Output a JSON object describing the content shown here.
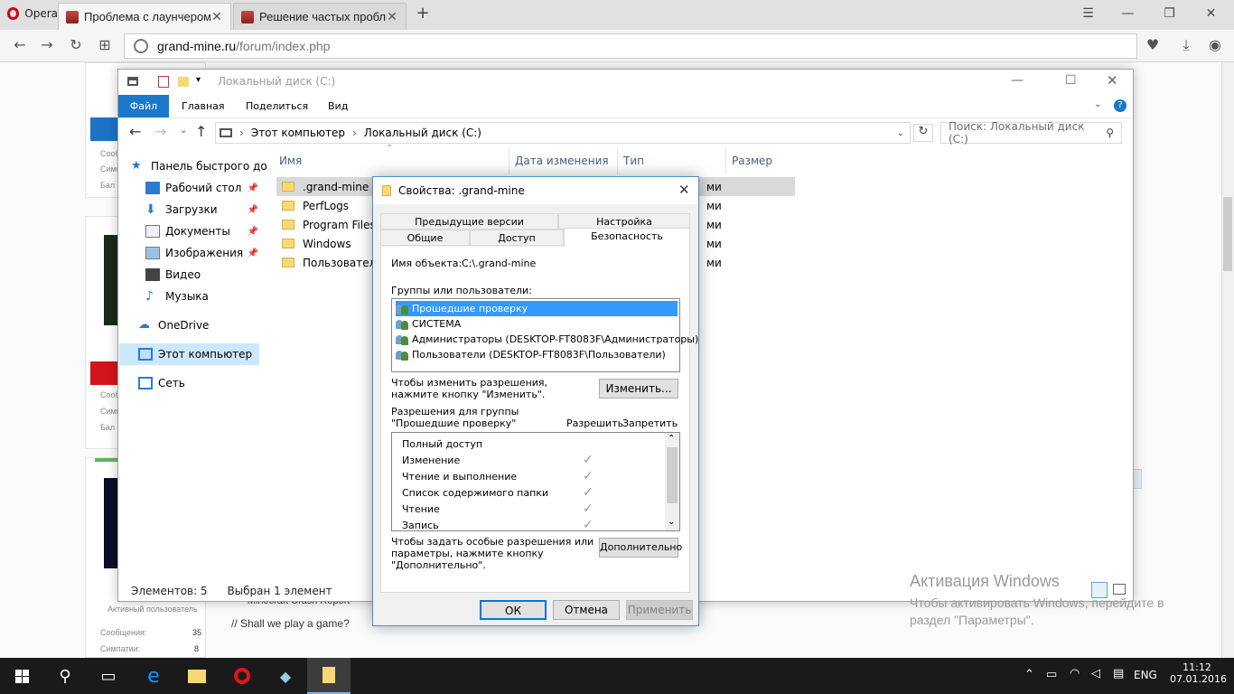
{
  "browser": {
    "menu_label": "Opera",
    "tabs": [
      {
        "title": "Проблема с лаунчером.",
        "active": true
      },
      {
        "title": "Решение частых пробле",
        "active": false
      }
    ],
    "new_tab": "+",
    "url_host": "grand-mine.ru",
    "url_path": "/forum/index.php"
  },
  "page": {
    "card1": {
      "lines": [
        "Сообщ",
        "Симп",
        "Бал"
      ]
    },
    "card2": {
      "lines": [
        "Сообщ",
        "Симп",
        "Бал"
      ]
    },
    "card3": {
      "role": "Активный пользователь",
      "stats": [
        {
          "label": "Сообщения:",
          "value": "35"
        },
        {
          "label": "Симпатии:",
          "value": "8"
        }
      ]
    },
    "post_lines": [
      "---- Minecraft Crash Report ----",
      "// Shall we play a game?"
    ]
  },
  "explorer": {
    "title": "Локальный диск (C:)",
    "ribbon_tabs": [
      "Файл",
      "Главная",
      "Поделиться",
      "Вид"
    ],
    "breadcrumb": [
      "Этот компьютер",
      "Локальный диск (C:)"
    ],
    "search_placeholder": "Поиск: Локальный диск (C:)",
    "nav": [
      {
        "label": "Панель быстрого до",
        "icon": "star-icon"
      },
      {
        "label": "Рабочий стол",
        "icon": "desktop-icon",
        "pinned": true
      },
      {
        "label": "Загрузки",
        "icon": "download-icon",
        "pinned": true
      },
      {
        "label": "Документы",
        "icon": "documents-icon",
        "pinned": true
      },
      {
        "label": "Изображения",
        "icon": "pictures-icon",
        "pinned": true
      },
      {
        "label": "Видео",
        "icon": "video-icon"
      },
      {
        "label": "Музыка",
        "icon": "music-icon"
      },
      {
        "label": "OneDrive",
        "icon": "onedrive-icon"
      },
      {
        "label": "Этот компьютер",
        "icon": "computer-icon",
        "selected": true
      },
      {
        "label": "Сеть",
        "icon": "network-icon"
      }
    ],
    "columns": [
      "Имя",
      "Дата изменения",
      "Тип",
      "Размер"
    ],
    "files": [
      {
        "name": ".grand-mine",
        "type_fragment": "ми",
        "selected": true
      },
      {
        "name": "PerfLogs",
        "type_fragment": "ми"
      },
      {
        "name": "Program Files",
        "type_fragment": "ми"
      },
      {
        "name": "Windows",
        "type_fragment": "ми"
      },
      {
        "name": "Пользователи",
        "type_fragment": "ми"
      }
    ],
    "status": {
      "count": "Элементов: 5",
      "selected": "Выбран 1 элемент"
    }
  },
  "dialog": {
    "title": "Свойства: .grand-mine",
    "tabs_row1": [
      "Предыдущие версии",
      "Настройка"
    ],
    "tabs_row2": [
      "Общие",
      "Доступ",
      "Безопасность"
    ],
    "active_tab": "Безопасность",
    "object_label": "Имя объекта:",
    "object_value": "C:\\.grand-mine",
    "groups_label": "Группы или пользователи:",
    "users": [
      "Прошедшие проверку",
      "СИСТЕМА",
      "Администраторы (DESKTOP-FT8083F\\Администраторы)",
      "Пользователи (DESKTOP-FT8083F\\Пользователи)"
    ],
    "change_hint_1": "Чтобы изменить разрешения,",
    "change_hint_2": "нажмите кнопку \"Изменить\".",
    "change_button": "Изменить...",
    "perms_for_1": "Разрешения для группы",
    "perms_for_2": "\"Прошедшие проверку\"",
    "allow_header": "Разрешить",
    "deny_header": "Запретить",
    "permissions": [
      {
        "name": "Полный доступ",
        "allow": false
      },
      {
        "name": "Изменение",
        "allow": true
      },
      {
        "name": "Чтение и выполнение",
        "allow": true
      },
      {
        "name": "Список содержимого папки",
        "allow": true
      },
      {
        "name": "Чтение",
        "allow": true
      },
      {
        "name": "Запись",
        "allow": true
      }
    ],
    "advanced_hint_1": "Чтобы задать особые разрешения или",
    "advanced_hint_2": "параметры, нажмите кнопку",
    "advanced_hint_3": "\"Дополнительно\".",
    "advanced_button": "Дополнительно",
    "ok": "ОК",
    "cancel": "Отмена",
    "apply": "Применить"
  },
  "watermark": {
    "title": "Активация Windows",
    "line1": "Чтобы активировать Windows, перейдите в",
    "line2": "раздел \"Параметры\"."
  },
  "taskbar": {
    "lang": "ENG",
    "time": "11:12",
    "date": "07.01.2016"
  },
  "colors": {
    "accent": "#1979ca",
    "selection": "#3399ff",
    "taskbar": "#1a1a1a"
  }
}
